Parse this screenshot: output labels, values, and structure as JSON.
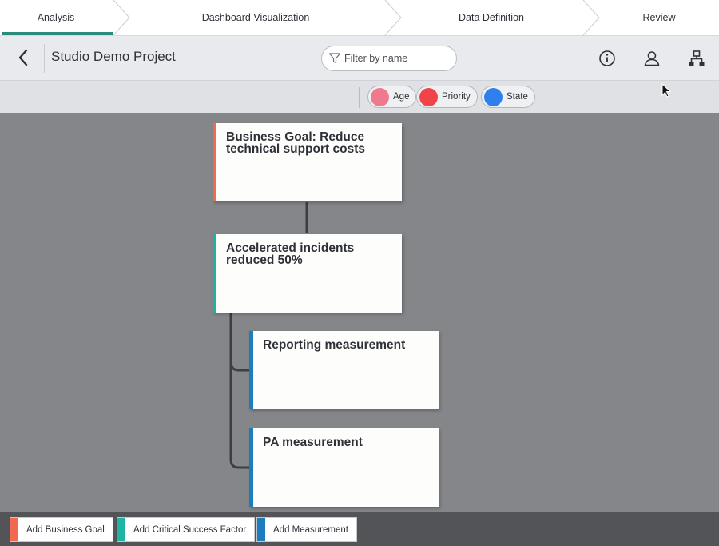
{
  "steps": [
    {
      "label": "Analysis",
      "active": true
    },
    {
      "label": "Dashboard Visualization",
      "active": false
    },
    {
      "label": "Data Definition",
      "active": false
    },
    {
      "label": "Review",
      "active": false
    }
  ],
  "header": {
    "title": "Studio Demo Project",
    "filter_placeholder": "Filter by name",
    "icons": [
      "back-chevron-icon",
      "filter-funnel-icon",
      "info-icon",
      "user-icon",
      "hierarchy-icon"
    ]
  },
  "legend": [
    {
      "label": "Age",
      "color": "#ef7a8e"
    },
    {
      "label": "Priority",
      "color": "#f0434a"
    },
    {
      "label": "State",
      "color": "#2f80ed"
    }
  ],
  "cards": {
    "goal": {
      "title": "Business Goal: Reduce technical support costs",
      "type": "business-goal"
    },
    "csf": {
      "title": "Accelerated incidents reduced 50%",
      "type": "critical-success-factor"
    },
    "measurement_1": {
      "title": "Reporting measurement",
      "type": "measurement"
    },
    "measurement_2": {
      "title": "PA measurement",
      "type": "measurement"
    }
  },
  "colors": {
    "business_goal": "#ef6a4e",
    "critical_success_factor": "#1fb3a4",
    "measurement": "#1b7dbd",
    "active_step": "#2b8a7e",
    "canvas": "#85868a"
  },
  "bottom_bar": {
    "add_business_goal": "Add Business Goal",
    "add_critical_success_factor": "Add Critical Success Factor",
    "add_measurement": "Add Measurement"
  }
}
